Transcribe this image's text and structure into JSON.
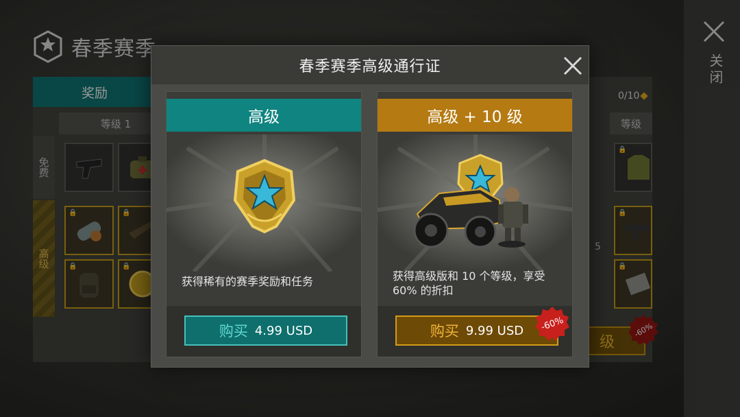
{
  "background": {
    "season_title": "春季赛季",
    "close_label": "关闭",
    "tab_rewards": "奖励",
    "progress": "0/10",
    "columns": [
      "等级 1",
      "等级"
    ],
    "row_free": "免费",
    "row_premium": "高级",
    "slot_number": "5",
    "buy_partial": "级",
    "discount": "-60%"
  },
  "modal": {
    "title": "春季赛季高级通行证",
    "cards": [
      {
        "ribbon": "高级",
        "description": "获得稀有的赛季奖励和任务",
        "buy_verb": "购买",
        "price": "4.99 USD"
      },
      {
        "ribbon": "高级 + 10 级",
        "description": "获得高级版和 10 个等级，享受 60% 的折扣",
        "buy_verb": "购买",
        "price": "9.99 USD",
        "discount": "-60%"
      }
    ]
  },
  "colors": {
    "teal": "#0f8480",
    "gold": "#b57a12",
    "badge_red": "#c8201c"
  },
  "icons": [
    "season-emblem-icon",
    "close-icon",
    "star-badge-icon",
    "vehicle-soldier-icon"
  ]
}
